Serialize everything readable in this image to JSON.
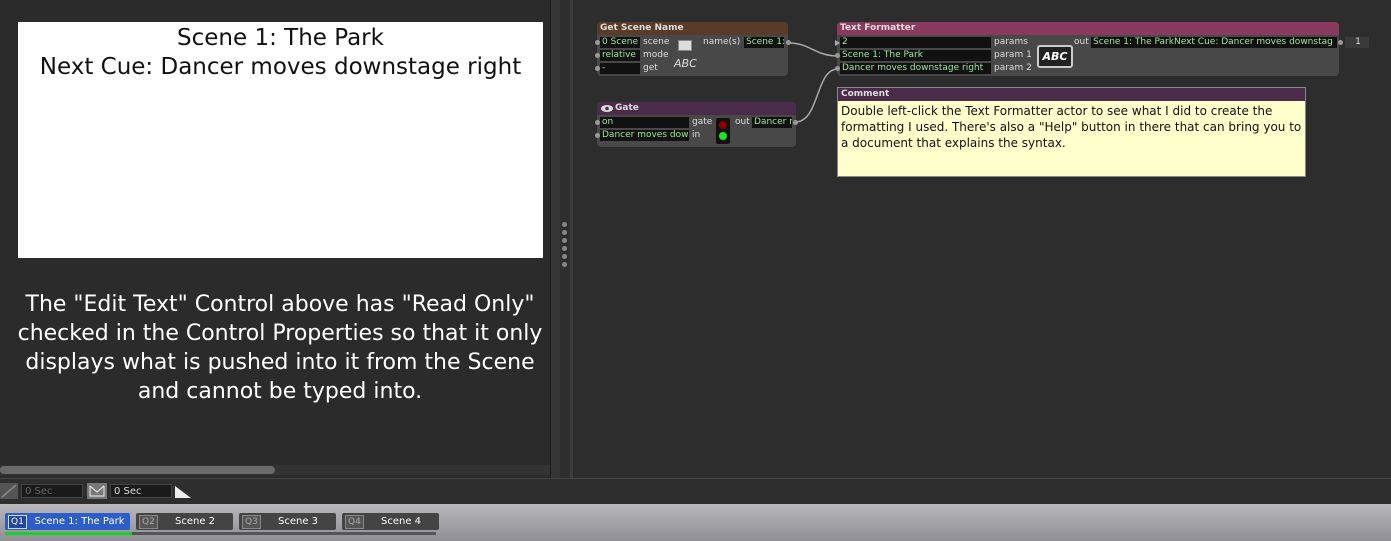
{
  "control_panel": {
    "display_line1": "Scene 1: The Park",
    "display_line2": "Next Cue: Dancer moves downstage right",
    "help_text": "The \"Edit Text\" Control above has \"Read Only\" checked in the Control Properties so that it only displays what is pushed into it from the Scene and cannot be typed into."
  },
  "get_scene_name": {
    "title": "Get Scene Name",
    "scene_value": "0 Scene",
    "scene_label": "scene",
    "mode_value": "relative",
    "mode_label": "mode",
    "get_value": "-",
    "get_label": "get",
    "names_label": "name(s)",
    "names_value": "Scene 1:",
    "abc_label": "ABC"
  },
  "gate": {
    "title": "Gate",
    "gate_value": "on",
    "gate_label": "gate",
    "in_value": "Dancer moves dow",
    "in_label": "in",
    "out_label": "out",
    "out_value": "Dancer r"
  },
  "text_formatter": {
    "title": "Text Formatter",
    "params_value": "2",
    "params_label": "params",
    "param1_value": "Scene 1: The Park",
    "param1_label": "param 1",
    "param2_value": "Dancer moves downstage right",
    "param2_label": "param 2",
    "abc_label": "ABC",
    "out_label": "out",
    "out_value": "Scene 1: The ParkNext Cue: Dancer moves downstag",
    "count_value": "1"
  },
  "comment": {
    "title": "Comment",
    "text": "Double left-click the Text Formatter actor to see what I did to create the formatting I used. There's also a \"Help\" button in there that can bring you to a document that explains the syntax."
  },
  "timeline": {
    "fade_in": "0 Sec",
    "fade_out": "0 Sec"
  },
  "scenes": [
    {
      "num": "Q1",
      "name": "Scene 1: The Park"
    },
    {
      "num": "Q2",
      "name": "Scene 2"
    },
    {
      "num": "Q3",
      "name": "Scene 3"
    },
    {
      "num": "Q4",
      "name": "Scene 4"
    }
  ],
  "colors": {
    "get_scene_header": "#5a3a28",
    "gate_header": "#4a2b4a",
    "text_formatter_header": "#8a3a5e",
    "comment_header": "#4a2b4a",
    "comment_bg": "#ffffcc",
    "active_scene": "#2c5ec9"
  }
}
